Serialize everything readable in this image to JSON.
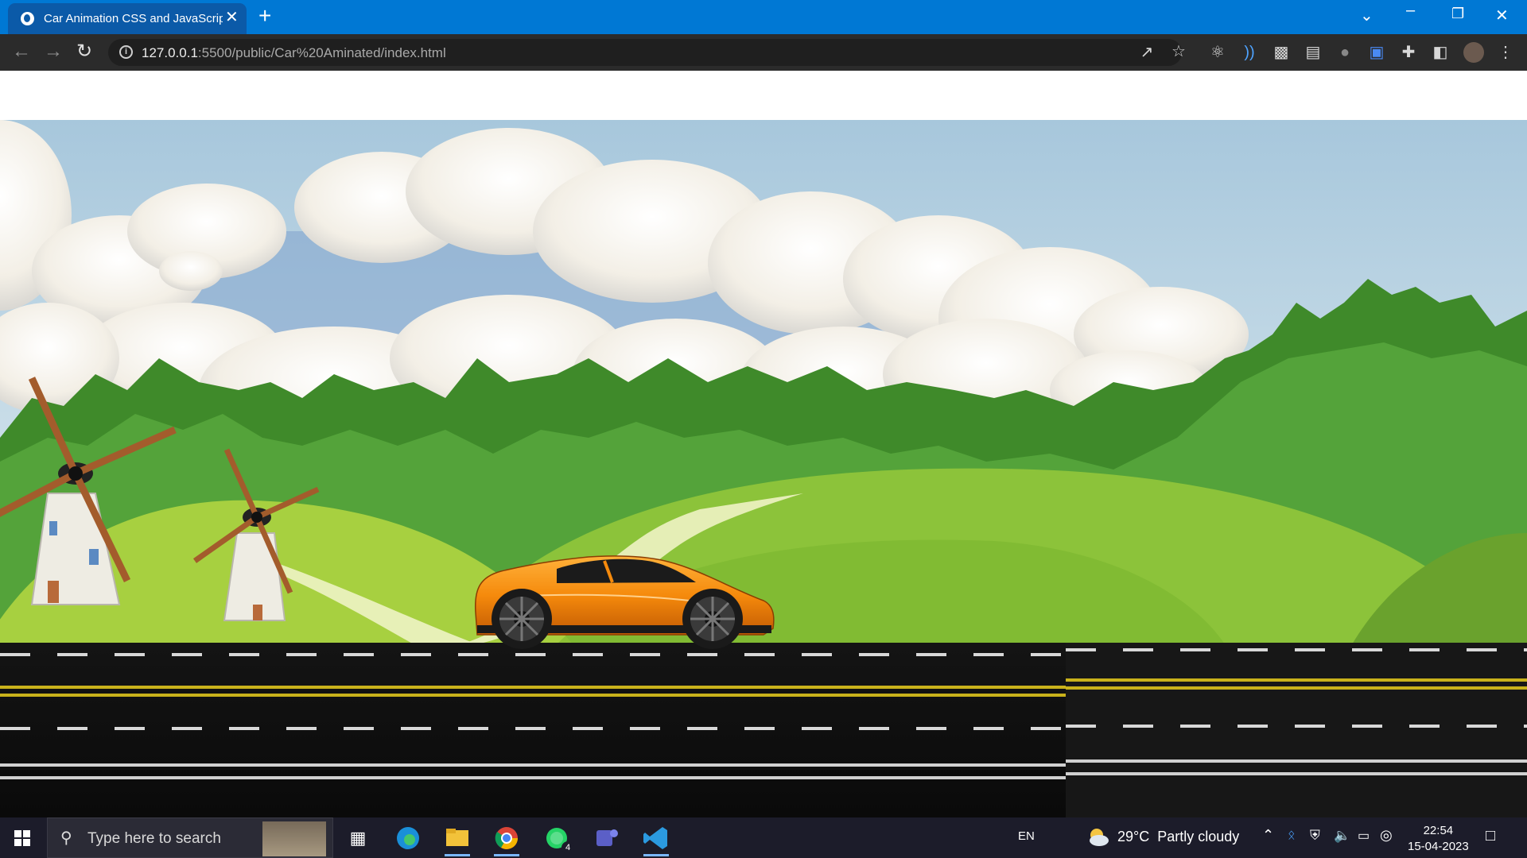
{
  "browser": {
    "tab_title": "Car Animation CSS and JavaScript",
    "tab_close": "✕",
    "new_tab": "+",
    "url_host": "127.0.0.1",
    "url_rest": ":5500/public/Car%20Aminated/index.html"
  },
  "taskbar": {
    "search_placeholder": "Type here to search",
    "language": "EN",
    "weather": "29°C  Partly cloudy",
    "time": "22:54",
    "date": "15-04-2023",
    "whatsapp_badge": "4"
  }
}
